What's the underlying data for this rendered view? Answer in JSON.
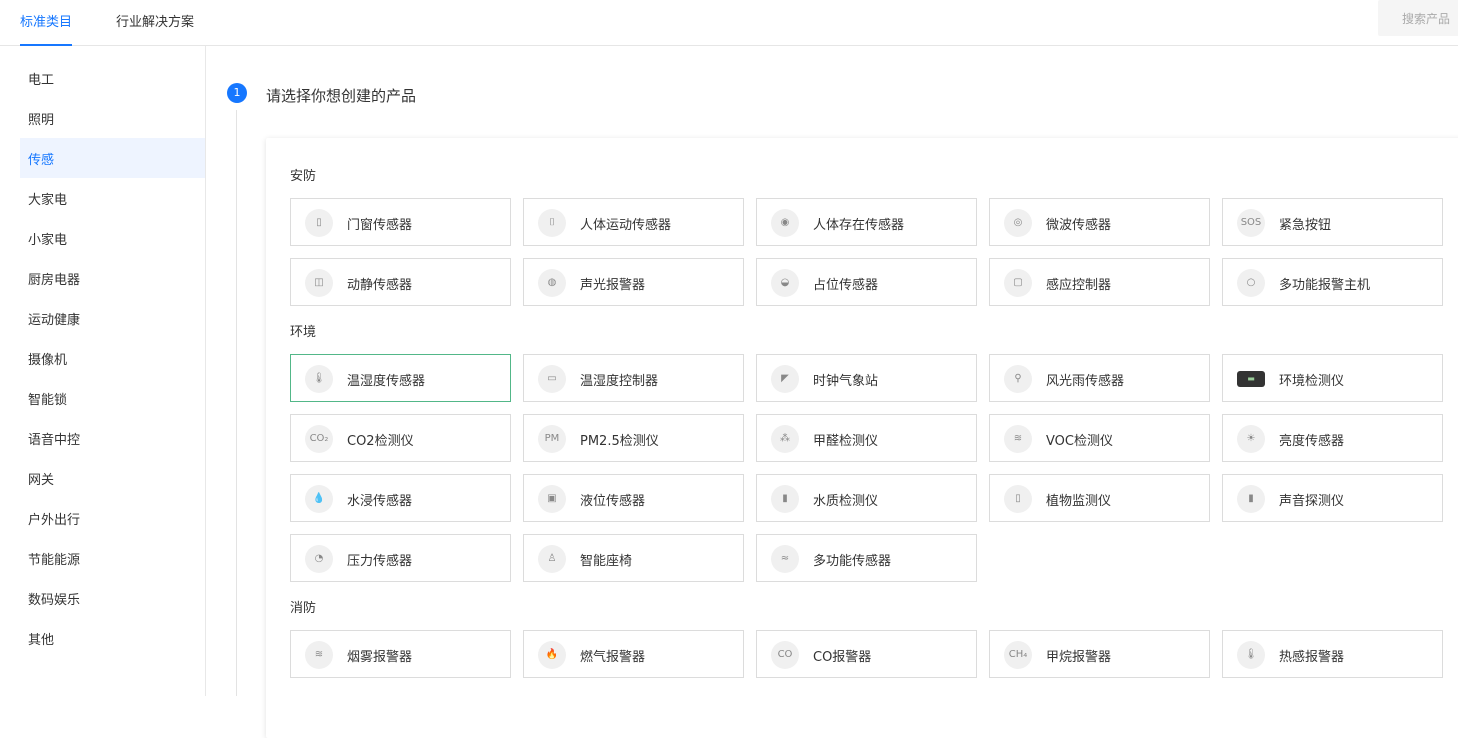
{
  "topbar": {
    "tabs": [
      {
        "label": "标准类目",
        "active": true
      },
      {
        "label": "行业解决方案",
        "active": false
      }
    ],
    "search_placeholder": "搜索产品"
  },
  "sidebar": {
    "items": [
      {
        "label": "电工"
      },
      {
        "label": "照明"
      },
      {
        "label": "传感",
        "active": true
      },
      {
        "label": "大家电"
      },
      {
        "label": "小家电"
      },
      {
        "label": "厨房电器"
      },
      {
        "label": "运动健康"
      },
      {
        "label": "摄像机"
      },
      {
        "label": "智能锁"
      },
      {
        "label": "语音中控"
      },
      {
        "label": "网关"
      },
      {
        "label": "户外出行"
      },
      {
        "label": "节能能源"
      },
      {
        "label": "数码娱乐"
      },
      {
        "label": "其他"
      }
    ]
  },
  "step": {
    "number": "1",
    "title": "请选择你想创建的产品"
  },
  "sections": [
    {
      "title": "安防",
      "items": [
        {
          "label": "门窗传感器",
          "icon": "door-sensor-icon",
          "glyph": "▯"
        },
        {
          "label": "人体运动传感器",
          "icon": "motion-sensor-icon",
          "glyph": "⌷"
        },
        {
          "label": "人体存在传感器",
          "icon": "presence-sensor-icon",
          "glyph": "◉"
        },
        {
          "label": "微波传感器",
          "icon": "microwave-sensor-icon",
          "glyph": "◎"
        },
        {
          "label": "紧急按钮",
          "icon": "sos-button-icon",
          "glyph": "SOS"
        },
        {
          "label": "动静传感器",
          "icon": "vibration-sensor-icon",
          "glyph": "◫"
        },
        {
          "label": "声光报警器",
          "icon": "siren-icon",
          "glyph": "◍"
        },
        {
          "label": "占位传感器",
          "icon": "occupancy-sensor-icon",
          "glyph": "◒"
        },
        {
          "label": "感应控制器",
          "icon": "sensing-controller-icon",
          "glyph": "▢"
        },
        {
          "label": "多功能报警主机",
          "icon": "alarm-host-icon",
          "glyph": "○"
        }
      ]
    },
    {
      "title": "环境",
      "items": [
        {
          "label": "温湿度传感器",
          "icon": "thermometer-icon",
          "glyph": "🌡"
        },
        {
          "label": "温湿度控制器",
          "icon": "thermo-controller-icon",
          "glyph": "▭"
        },
        {
          "label": "时钟气象站",
          "icon": "weather-station-icon",
          "glyph": "◤"
        },
        {
          "label": "风光雨传感器",
          "icon": "wind-rain-sensor-icon",
          "glyph": "⚲"
        },
        {
          "label": "环境检测仪",
          "icon": "environment-monitor-icon",
          "glyph": "▬"
        },
        {
          "label": "CO2检测仪",
          "icon": "co2-icon",
          "glyph": "CO₂"
        },
        {
          "label": "PM2.5检测仪",
          "icon": "pm25-icon",
          "glyph": "PM"
        },
        {
          "label": "甲醛检测仪",
          "icon": "formaldehyde-icon",
          "glyph": "⁂"
        },
        {
          "label": "VOC检测仪",
          "icon": "voc-icon",
          "glyph": "≋"
        },
        {
          "label": "亮度传感器",
          "icon": "brightness-icon",
          "glyph": "☀"
        },
        {
          "label": "水浸传感器",
          "icon": "water-leak-icon",
          "glyph": "💧"
        },
        {
          "label": "液位传感器",
          "icon": "liquid-level-icon",
          "glyph": "▣"
        },
        {
          "label": "水质检测仪",
          "icon": "water-quality-icon",
          "glyph": "▮"
        },
        {
          "label": "植物监测仪",
          "icon": "plant-monitor-icon",
          "glyph": "▯"
        },
        {
          "label": "声音探测仪",
          "icon": "sound-detector-icon",
          "glyph": "▮"
        },
        {
          "label": "压力传感器",
          "icon": "pressure-gauge-icon",
          "glyph": "◔"
        },
        {
          "label": "智能座椅",
          "icon": "smart-chair-icon",
          "glyph": "♙"
        },
        {
          "label": "多功能传感器",
          "icon": "multi-sensor-icon",
          "glyph": "≈"
        }
      ]
    },
    {
      "title": "消防",
      "items": [
        {
          "label": "烟雾报警器",
          "icon": "smoke-icon",
          "glyph": "≋"
        },
        {
          "label": "燃气报警器",
          "icon": "flame-icon",
          "glyph": "🔥"
        },
        {
          "label": "CO报警器",
          "icon": "co-icon",
          "glyph": "CO"
        },
        {
          "label": "甲烷报警器",
          "icon": "methane-icon",
          "glyph": "CH₄"
        },
        {
          "label": "热感报警器",
          "icon": "heat-icon",
          "glyph": "🌡"
        }
      ]
    }
  ],
  "selected_item": "温湿度传感器",
  "colors": {
    "accent": "#1677ff",
    "selected_border": "#52b788"
  }
}
